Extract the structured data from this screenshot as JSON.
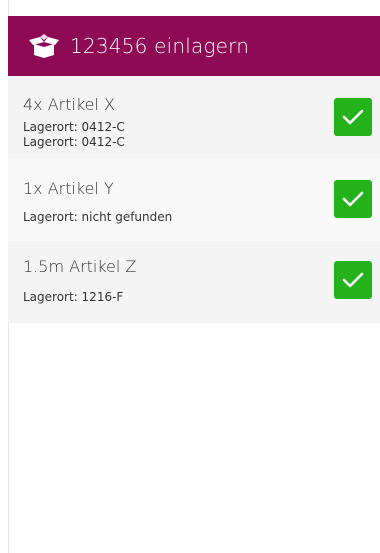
{
  "colors": {
    "header_bg": "#8e0a55",
    "check_bg": "#23b21a"
  },
  "header": {
    "icon": "open-box-icon",
    "title": "123456 einlagern"
  },
  "items": [
    {
      "title": "4x Artikel X",
      "locations": [
        "Lagerort: 0412-C",
        "Lagerort: 0412-C"
      ],
      "action_icon": "checkmark-icon"
    },
    {
      "title": "1x Artikel Y",
      "locations": [
        "Lagerort: nicht gefunden"
      ],
      "action_icon": "checkmark-icon"
    },
    {
      "title": "1.5m Artikel Z",
      "locations": [
        "Lagerort: 1216-F"
      ],
      "action_icon": "checkmark-icon"
    }
  ]
}
